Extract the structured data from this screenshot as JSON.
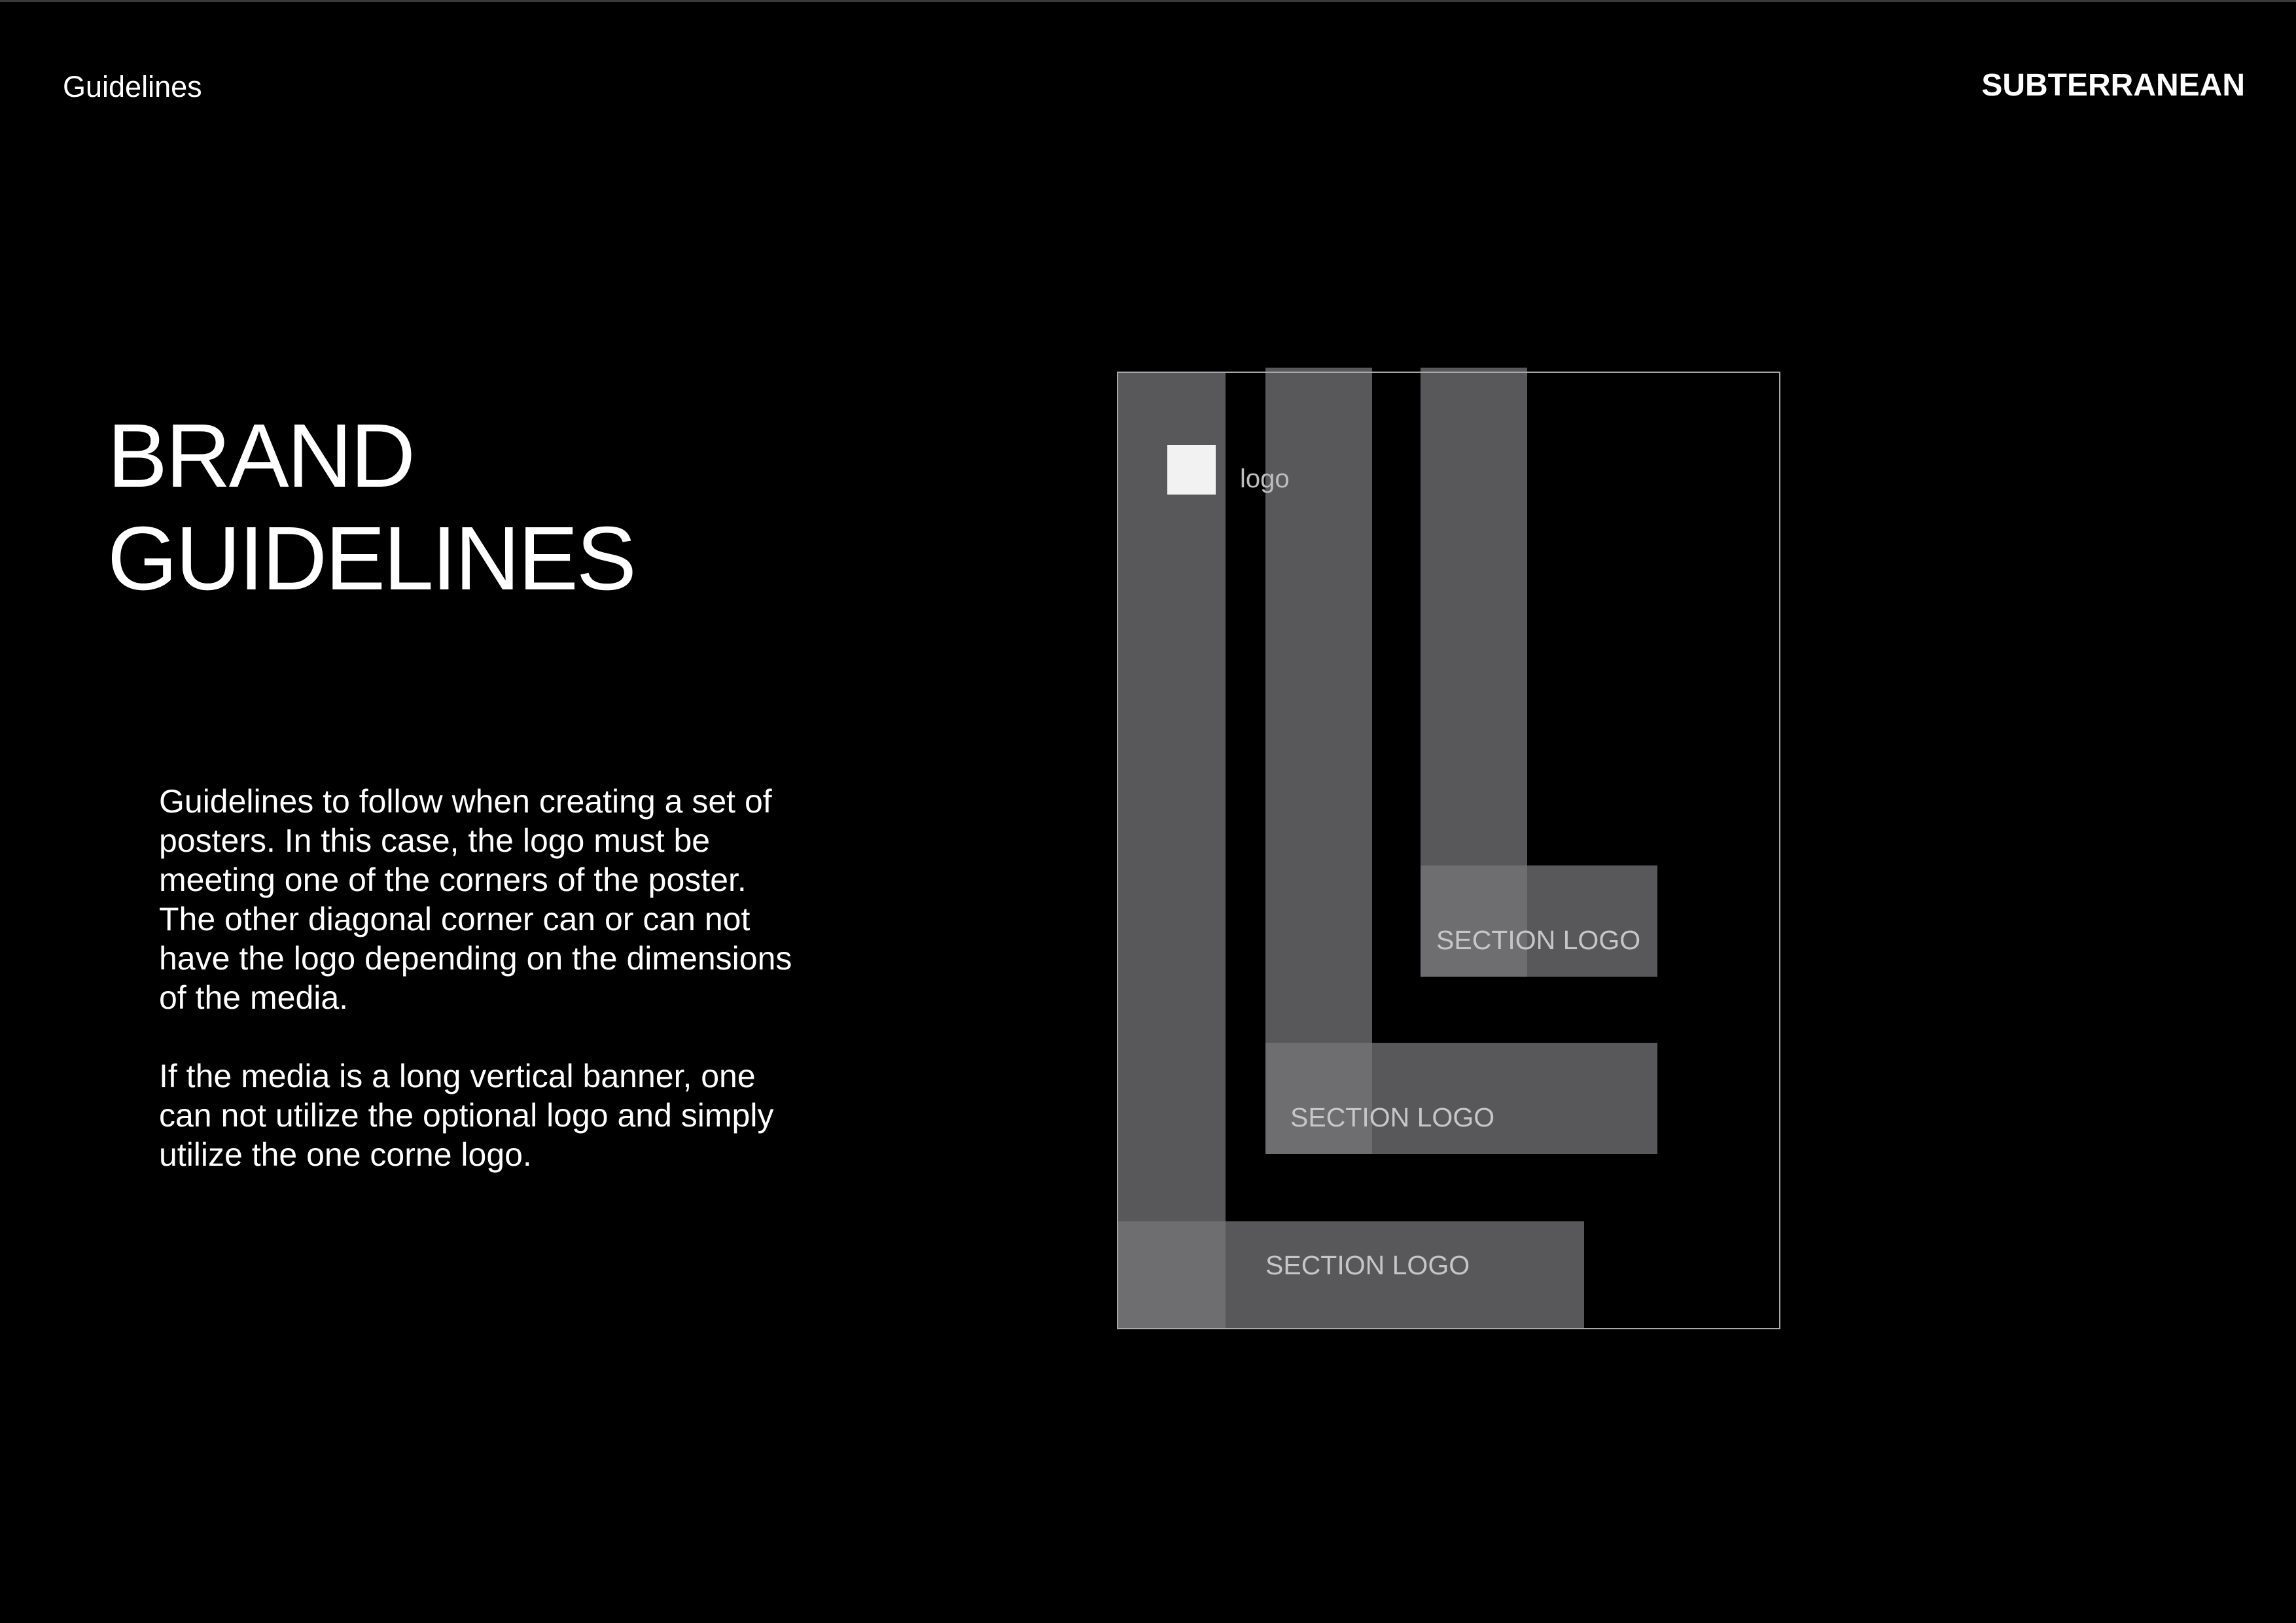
{
  "header": {
    "section_label": "Guidelines",
    "brand_name": "SUBTERRANEAN"
  },
  "title": {
    "lines": [
      "BRAND",
      "GUIDELINES"
    ]
  },
  "body": {
    "paragraphs": [
      {
        "lines": [
          "Guidelines to follow when creating a set of",
          "posters. In this case, the logo must be",
          "meeting one of the corners of the poster.",
          "The other diagonal corner can or can not",
          "have the logo depending on the dimensions",
          "of the media."
        ]
      },
      {
        "lines": [
          "If the media is a long vertical banner, one",
          "can not utilize the optional logo and simply",
          "utilize the one corne logo."
        ]
      }
    ]
  },
  "diagram": {
    "logo_label": "logo",
    "section_logo_labels": [
      "SECTION LOGO",
      "SECTION LOGO",
      "SECTION LOGO"
    ]
  },
  "colors": {
    "background": "#000000",
    "text": "#ffffff",
    "bar": "#58585a",
    "bar_overlap": "#6e6e70",
    "logo_mark": "#f2f2f2",
    "frame_stroke": "#a8a8a8",
    "diagram_label": "#c6c6c6"
  }
}
